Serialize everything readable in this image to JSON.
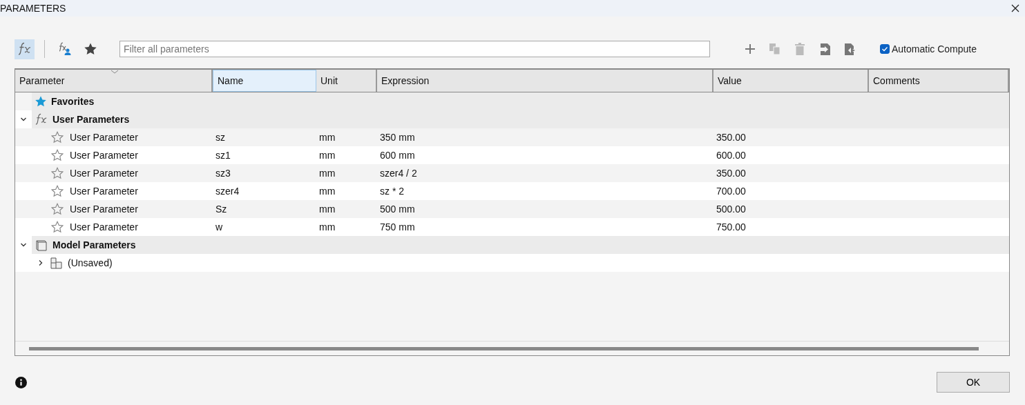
{
  "window": {
    "title": "PARAMETERS"
  },
  "toolbar": {
    "filters": [
      {
        "kind": "all",
        "selected": true
      },
      {
        "kind": "user",
        "selected": false
      },
      {
        "kind": "favorites",
        "selected": false
      }
    ],
    "search": {
      "placeholder": "Filter all parameters"
    },
    "actions": [
      {
        "kind": "add",
        "disabled": false
      },
      {
        "kind": "copy",
        "disabled": true
      },
      {
        "kind": "delete",
        "disabled": true
      },
      {
        "kind": "import",
        "disabled": false
      },
      {
        "kind": "export",
        "disabled": false
      }
    ],
    "automatic_compute": {
      "label": "Automatic Compute",
      "checked": true
    }
  },
  "table": {
    "columns": [
      {
        "label": "Parameter",
        "selected": false
      },
      {
        "label": "Name",
        "selected": true
      },
      {
        "label": "Unit",
        "selected": false
      },
      {
        "label": "Expression",
        "selected": false
      },
      {
        "label": "Value",
        "selected": false
      },
      {
        "label": "Comments",
        "selected": false
      }
    ],
    "groups": [
      {
        "kind": "favorites",
        "label": "Favorites"
      },
      {
        "kind": "user",
        "label": "User Parameters",
        "expanded": true,
        "children": [
          {
            "parameter": "User Parameter",
            "name": "sz",
            "unit": "mm",
            "expression": "350 mm",
            "value": "350.00",
            "favorite": false
          },
          {
            "parameter": "User Parameter",
            "name": "sz1",
            "unit": "mm",
            "expression": "600 mm",
            "value": "600.00",
            "favorite": false
          },
          {
            "parameter": "User Parameter",
            "name": "sz3",
            "unit": "mm",
            "expression": "szer4 / 2",
            "value": "350.00",
            "favorite": false
          },
          {
            "parameter": "User Parameter",
            "name": "szer4",
            "unit": "mm",
            "expression": "sz * 2",
            "value": "700.00",
            "favorite": false
          },
          {
            "parameter": "User Parameter",
            "name": "Sz",
            "unit": "mm",
            "expression": "500 mm",
            "value": "500.00",
            "favorite": false
          },
          {
            "parameter": "User Parameter",
            "name": "w",
            "unit": "mm",
            "expression": "750 mm",
            "value": "750.00",
            "favorite": false
          }
        ]
      },
      {
        "kind": "model",
        "label": "Model Parameters",
        "expanded": true,
        "children": [
          {
            "label": "(Unsaved)",
            "expanded": false
          }
        ]
      }
    ]
  },
  "buttons": [
    {
      "label": "OK"
    }
  ]
}
